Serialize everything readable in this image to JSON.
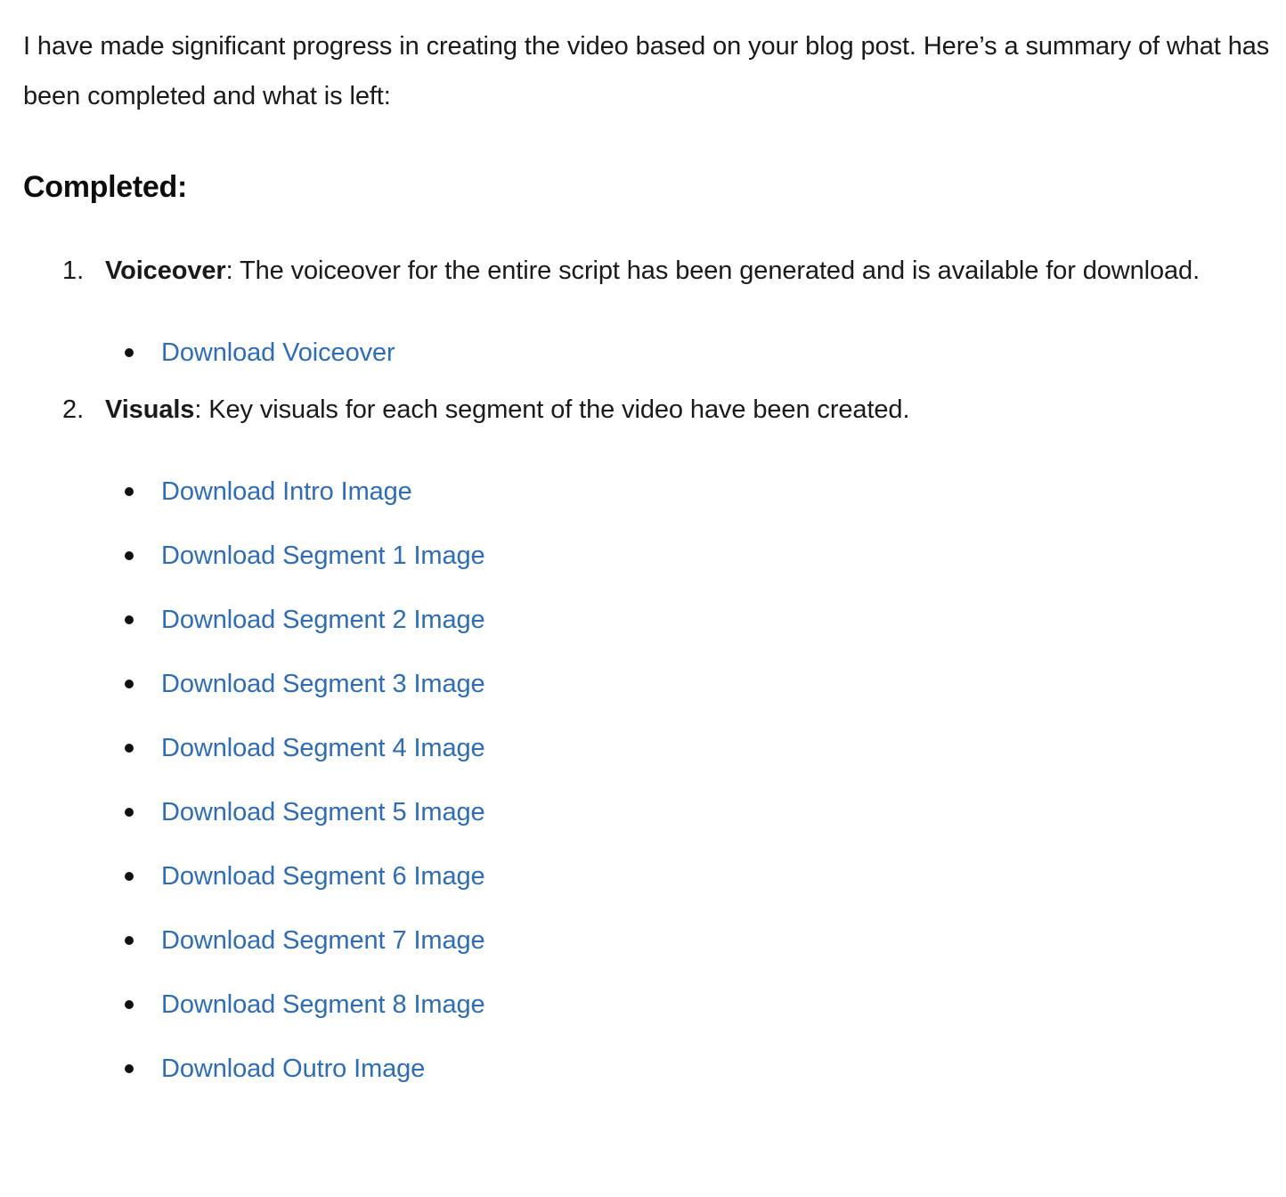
{
  "document": {
    "intro_paragraph": "I have made significant progress in creating the video based on your blog post. Here’s a summary of what has been completed and what is left:",
    "section_heading": "Completed:",
    "tasks": [
      {
        "marker": "1.",
        "label": "Voiceover",
        "separator": ": ",
        "description": "The voiceover for the entire script has been generated and is available for download.",
        "links": [
          {
            "label": "Download Voiceover"
          }
        ]
      },
      {
        "marker": "2.",
        "label": "Visuals",
        "separator": ": ",
        "description": "Key visuals for each segment of the video have been created.",
        "links": [
          {
            "label": "Download Intro Image"
          },
          {
            "label": "Download Segment 1 Image"
          },
          {
            "label": "Download Segment 2 Image"
          },
          {
            "label": "Download Segment 3 Image"
          },
          {
            "label": "Download Segment 4 Image"
          },
          {
            "label": "Download Segment 5 Image"
          },
          {
            "label": "Download Segment 6 Image"
          },
          {
            "label": "Download Segment 7 Image"
          },
          {
            "label": "Download Segment 8 Image"
          },
          {
            "label": "Download Outro Image"
          }
        ]
      }
    ]
  },
  "colors": {
    "background": "#ffffff",
    "body_text": "#1a1a1a",
    "heading_text": "#0d0d0d",
    "link": "#2f6cb4",
    "bullet": "#111111"
  }
}
